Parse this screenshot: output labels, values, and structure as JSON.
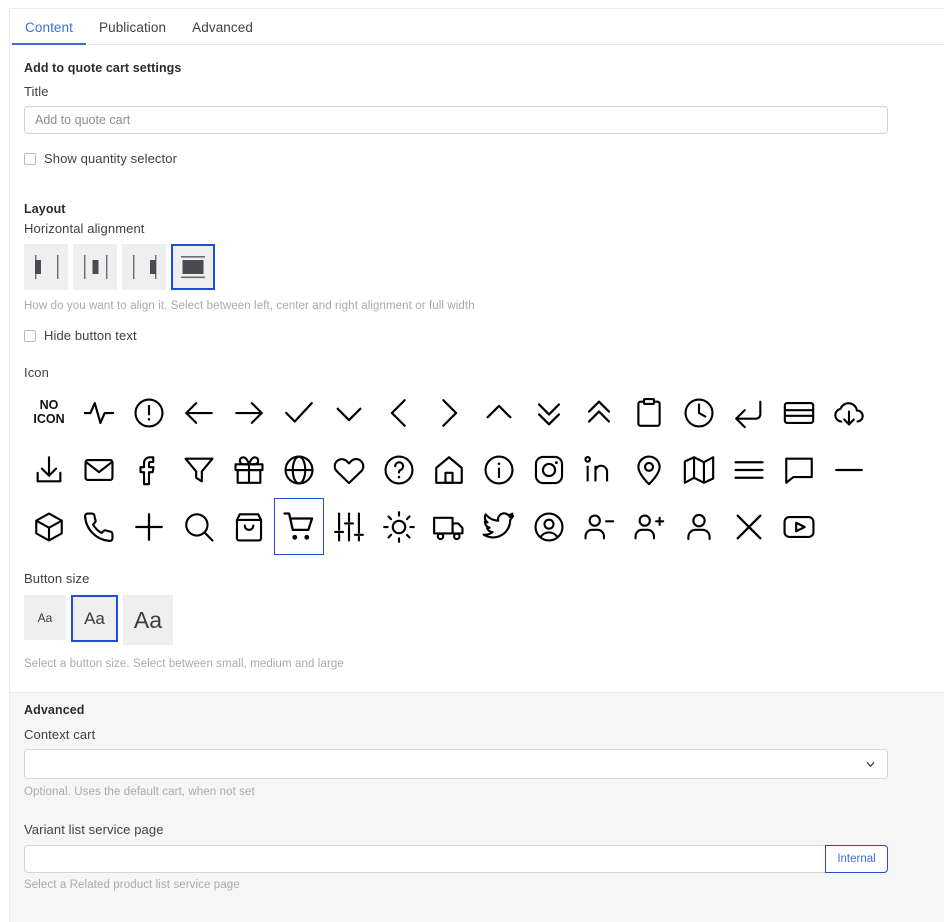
{
  "tabs": [
    {
      "label": "Content",
      "active": true
    },
    {
      "label": "Publication",
      "active": false
    },
    {
      "label": "Advanced",
      "active": false
    }
  ],
  "settings": {
    "section_title": "Add to quote cart settings",
    "title_label": "Title",
    "title_placeholder": "Add to quote cart",
    "title_value": "",
    "show_quantity_label": "Show quantity selector",
    "show_quantity_checked": false
  },
  "layout": {
    "section_title": "Layout",
    "alignment_label": "Horizontal alignment",
    "alignment_hint": "How do you want to align it. Select between left, center and right alignment or full width",
    "alignment_options": [
      {
        "name": "left",
        "selected": false
      },
      {
        "name": "center",
        "selected": false
      },
      {
        "name": "right",
        "selected": false
      },
      {
        "name": "full-width",
        "selected": true
      }
    ],
    "hide_button_text_label": "Hide button text",
    "hide_button_text_checked": false
  },
  "icon": {
    "label": "Icon",
    "selected": "shopping-cart",
    "no_icon_line1": "NO",
    "no_icon_line2": "ICON",
    "items": [
      "no-icon",
      "activity-icon",
      "alert-circle-icon",
      "arrow-left-icon",
      "arrow-right-icon",
      "check-icon",
      "chevron-down-icon",
      "chevron-left-icon",
      "chevron-right-icon",
      "chevron-up-icon",
      "chevrons-down-icon",
      "chevrons-up-icon",
      "clipboard-icon",
      "clock-icon",
      "corner-down-left-icon",
      "credit-card-icon",
      "cloud-download-icon",
      "download-icon",
      "mail-icon",
      "facebook-icon",
      "filter-icon",
      "gift-icon",
      "globe-icon",
      "heart-icon",
      "help-circle-icon",
      "home-icon",
      "info-icon",
      "instagram-icon",
      "linkedin-icon",
      "map-pin-icon",
      "map-icon",
      "menu-icon",
      "message-square-icon",
      "minus-icon",
      "package-icon",
      "phone-icon",
      "plus-icon",
      "search-icon",
      "shopping-bag-icon",
      "shopping-cart-icon",
      "sliders-icon",
      "sun-icon",
      "truck-icon",
      "twitter-icon",
      "user-circle-icon",
      "user-minus-icon",
      "user-plus-icon",
      "user-icon",
      "x-icon",
      "youtube-icon"
    ]
  },
  "button_size": {
    "label": "Button size",
    "hint": "Select a button size. Select between small, medium and large",
    "options": [
      {
        "label": "Aa",
        "size": "small",
        "selected": false
      },
      {
        "label": "Aa",
        "size": "medium",
        "selected": true
      },
      {
        "label": "Aa",
        "size": "large",
        "selected": false
      }
    ]
  },
  "advanced": {
    "section_title": "Advanced",
    "context_cart_label": "Context cart",
    "context_cart_value": "",
    "context_cart_hint": "Optional. Uses the default cart, when not set",
    "variant_list_label": "Variant list service page",
    "variant_list_value": "",
    "variant_list_placeholder": "",
    "variant_list_button": "Internal",
    "variant_list_hint": "Select a Related product list service page"
  },
  "colors": {
    "accent": "#3b6fd4",
    "selected_border": "#1c4ed8",
    "swatch_bg": "#efeff0",
    "advanced_bg": "#f6f6f7",
    "hint_text": "#a9a9b0"
  }
}
